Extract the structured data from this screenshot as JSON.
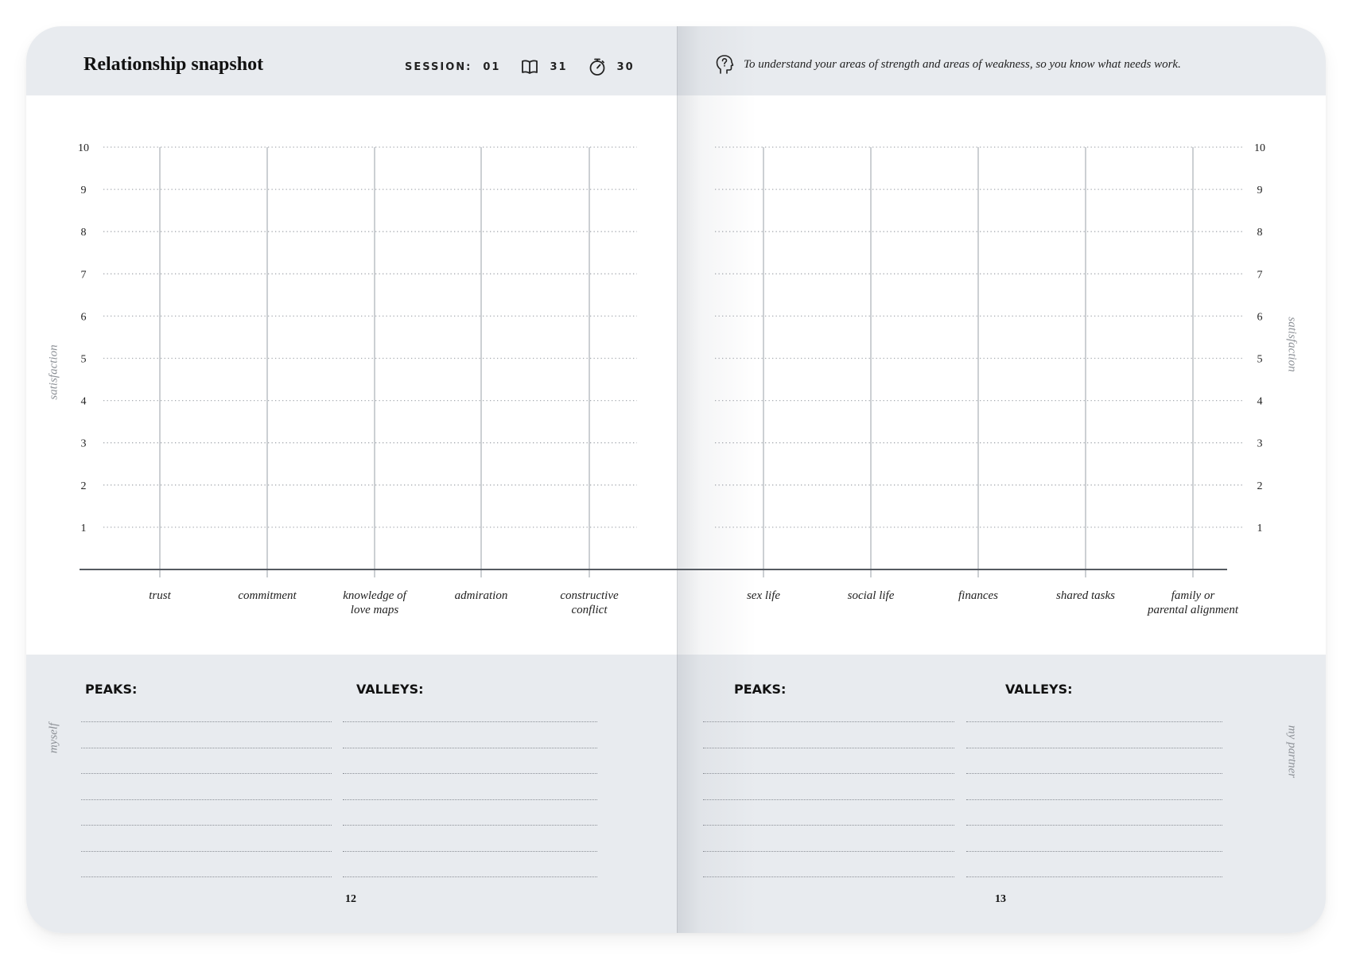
{
  "header": {
    "title": "Relationship snapshot",
    "session_label": "SESSION:",
    "session_number": "01",
    "book_icon": "book-icon",
    "book_page": "31",
    "timer_icon": "stopwatch-icon",
    "timer_minutes": "30",
    "purpose_icon": "head-question-icon",
    "purpose_text": "To understand your areas of strength and areas of weakness, so you know what needs work."
  },
  "chart_data": [
    {
      "type": "bar",
      "panel": "left",
      "categories": [
        "trust",
        "commitment",
        "knowledge of\nlove maps",
        "admiration",
        "constructive\nconflict"
      ],
      "values": [
        null,
        null,
        null,
        null,
        null
      ],
      "ylabel": "satisfaction",
      "yticks": [
        1,
        2,
        3,
        4,
        5,
        6,
        7,
        8,
        9,
        10
      ],
      "ylim": [
        0,
        10
      ],
      "grid": "dotted horizontal",
      "side_label": "myself"
    },
    {
      "type": "bar",
      "panel": "right",
      "categories": [
        "sex life",
        "social life",
        "finances",
        "shared tasks",
        "family or\nparental alignment"
      ],
      "values": [
        null,
        null,
        null,
        null,
        null
      ],
      "ylabel": "satisfaction",
      "yticks": [
        1,
        2,
        3,
        4,
        5,
        6,
        7,
        8,
        9,
        10
      ],
      "ylim": [
        0,
        10
      ],
      "grid": "dotted horizontal",
      "side_label": "my partner"
    }
  ],
  "left_page": {
    "peaks_label": "PEAKS:",
    "valleys_label": "VALLEYS:",
    "side_label": "myself",
    "page_number": "12"
  },
  "right_page": {
    "peaks_label": "PEAKS:",
    "valleys_label": "VALLEYS:",
    "side_label": "my partner",
    "page_number": "13"
  },
  "colors": {
    "band": "#e8ebef",
    "grid": "#a7abb1",
    "axis": "#555a61",
    "muted_label": "#8c9096"
  }
}
